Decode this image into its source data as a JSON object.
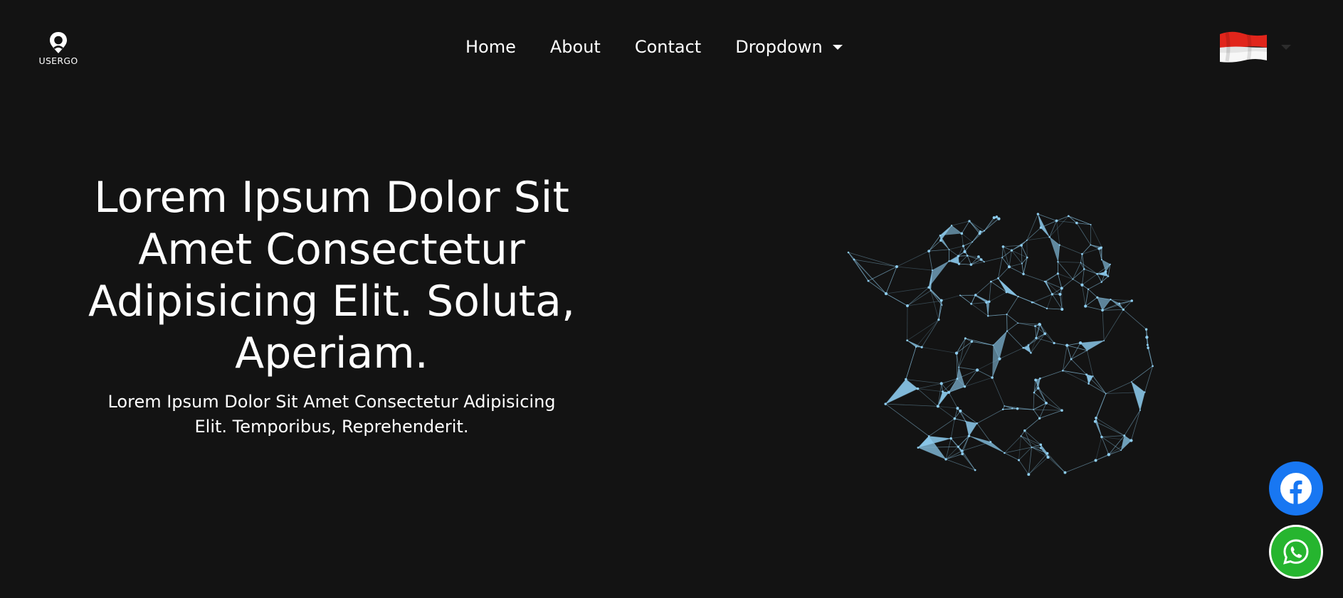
{
  "brand": {
    "logo_text": "USERGO",
    "logo_icon": "location-pin-icon"
  },
  "nav": {
    "items": [
      {
        "label": "Home"
      },
      {
        "label": "About"
      },
      {
        "label": "Contact"
      }
    ],
    "dropdown_label": "Dropdown",
    "dropdown_icon": "caret-down-icon"
  },
  "language": {
    "selected_flag": "indonesia-flag-icon",
    "flag_colors": {
      "top": "#e1251b",
      "bottom": "#ffffff"
    }
  },
  "hero": {
    "title": "Lorem Ipsum Dolor Sit Amet Consectetur Adipisicing Elit. Soluta, Aperiam.",
    "subtitle": "Lorem Ipsum Dolor Sit Amet Consectetur Adipisicing Elit. Temporibus, Reprehenderit."
  },
  "social": {
    "facebook_icon": "facebook-icon",
    "whatsapp_icon": "whatsapp-icon"
  },
  "colors": {
    "background": "#131313",
    "text": "#ffffff",
    "facebook": "#1877f2",
    "whatsapp": "#26b52f",
    "network_line": "#7fb3cf",
    "network_fill": "#8ecdf0"
  }
}
